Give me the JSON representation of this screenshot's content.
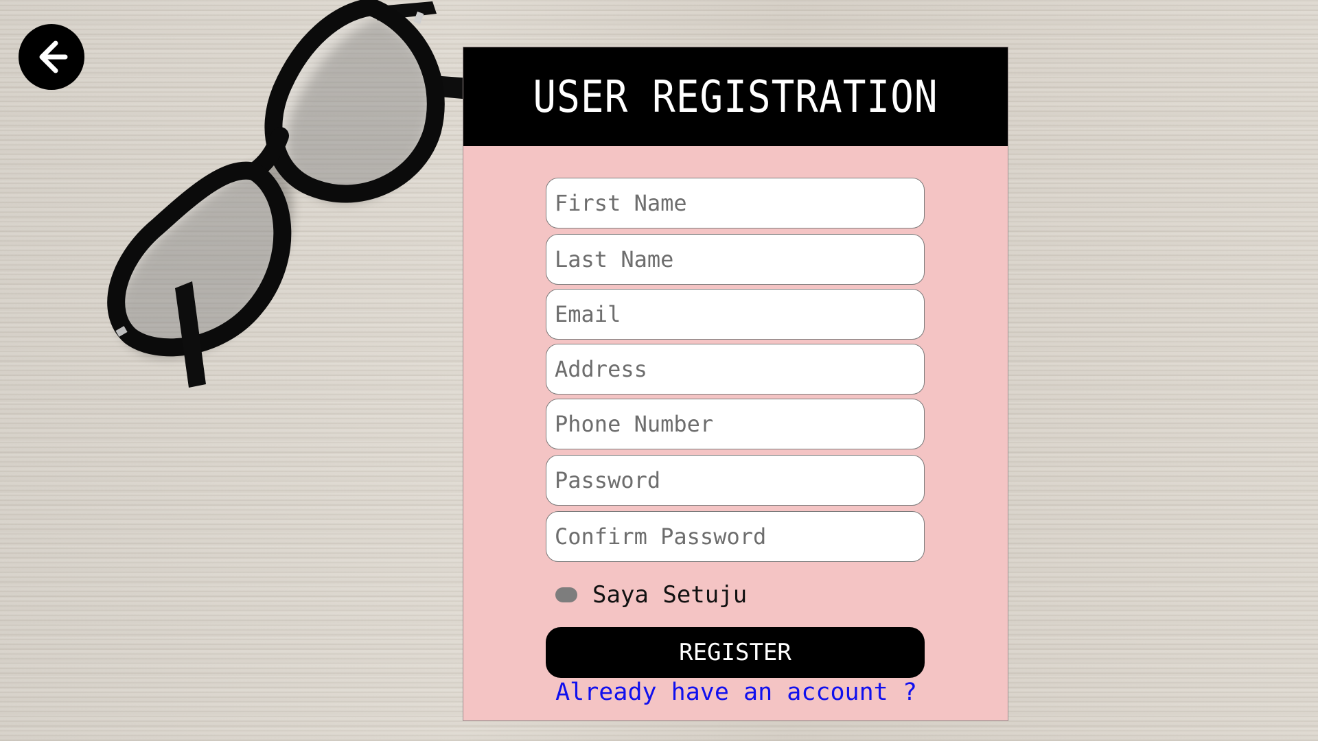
{
  "page": {
    "title": "USER REGISTRATION"
  },
  "nav": {
    "back_icon": "arrow-left-icon"
  },
  "form": {
    "fields": [
      {
        "placeholder": "First Name",
        "value": ""
      },
      {
        "placeholder": "Last Name",
        "value": ""
      },
      {
        "placeholder": "Email",
        "value": ""
      },
      {
        "placeholder": "Address",
        "value": ""
      },
      {
        "placeholder": "Phone Number",
        "value": ""
      },
      {
        "placeholder": "Password",
        "value": ""
      },
      {
        "placeholder": "Confirm Password",
        "value": ""
      }
    ],
    "agree_label": "Saya Setuju",
    "register_label": "REGISTER",
    "login_link": "Already have an account ?"
  },
  "colors": {
    "card_bg": "#f4c4c4",
    "header_bg": "#000000",
    "link": "#1010ee"
  }
}
